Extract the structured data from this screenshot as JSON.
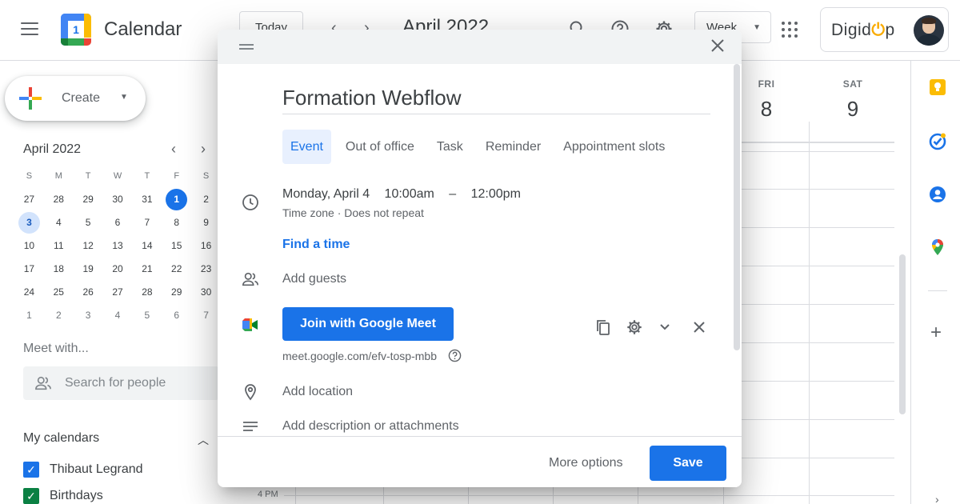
{
  "header": {
    "app_title": "Calendar",
    "logo_text": "1",
    "today_label": "Today",
    "prev_icon": "‹",
    "next_icon": "›",
    "month_title": "April 2022",
    "view_label": "Week",
    "account_brand_pre": "Digid",
    "account_brand_o": "⏻",
    "account_brand_post": "p"
  },
  "sidebar": {
    "create_label": "Create",
    "mini_calendar": {
      "title": "April 2022",
      "weekdays": [
        "S",
        "M",
        "T",
        "W",
        "T",
        "F",
        "S"
      ],
      "weeks": [
        [
          "27",
          "28",
          "29",
          "30",
          "31",
          "1",
          "2"
        ],
        [
          "3",
          "4",
          "5",
          "6",
          "7",
          "8",
          "9"
        ],
        [
          "10",
          "11",
          "12",
          "13",
          "14",
          "15",
          "16"
        ],
        [
          "17",
          "18",
          "19",
          "20",
          "21",
          "22",
          "23"
        ],
        [
          "24",
          "25",
          "26",
          "27",
          "28",
          "29",
          "30"
        ],
        [
          "1",
          "2",
          "3",
          "4",
          "5",
          "6",
          "7"
        ]
      ]
    },
    "meet_with": "Meet with...",
    "search_placeholder": "Search for people",
    "my_calendars_title": "My calendars",
    "calendars": [
      {
        "label": "Thibaut Legrand",
        "color": "#1a73e8"
      },
      {
        "label": "Birthdays",
        "color": "#0b8043"
      }
    ]
  },
  "grid": {
    "days": [
      {
        "name": "FRI",
        "date": "8"
      },
      {
        "name": "SAT",
        "date": "9"
      }
    ],
    "time_label": "4 PM"
  },
  "dialog": {
    "title": "Formation Webflow",
    "tabs": [
      "Event",
      "Out of office",
      "Task",
      "Reminder",
      "Appointment slots"
    ],
    "date": "Monday, April 4",
    "start_time": "10:00am",
    "dash": "–",
    "end_time": "12:00pm",
    "tz_line": "Time zone · Does not repeat",
    "find_time": "Find a time",
    "add_guests": "Add guests",
    "meet_button": "Join with Google Meet",
    "meet_link": "meet.google.com/efv-tosp-mbb",
    "add_location": "Add location",
    "add_description": "Add description or attachments",
    "more_options": "More options",
    "save": "Save"
  },
  "colors": {
    "accent": "#1a73e8",
    "selected_day_bg": "#d2e3fc"
  }
}
